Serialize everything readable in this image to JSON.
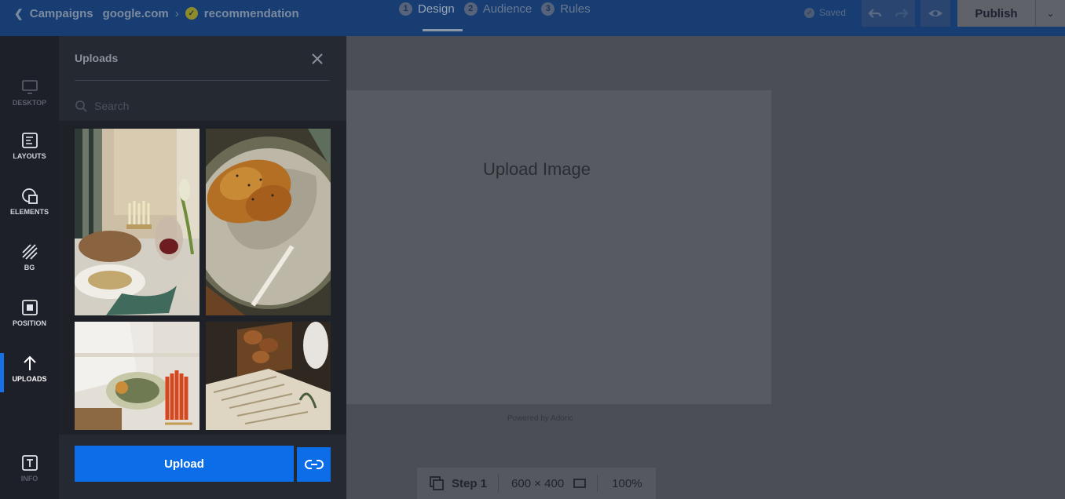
{
  "topbar": {
    "crumbs": [
      "Campaigns",
      "google.com",
      "recommendation"
    ],
    "steps": [
      {
        "num": "1",
        "label": "Design"
      },
      {
        "num": "2",
        "label": "Audience"
      },
      {
        "num": "3",
        "label": "Rules"
      }
    ],
    "saved_label": "Saved",
    "publish_label": "Publish"
  },
  "rail": {
    "items": [
      {
        "label": "DESKTOP",
        "icon": "monitor-icon"
      },
      {
        "label": "LAYOUTS",
        "icon": "layouts-icon"
      },
      {
        "label": "ELEMENTS",
        "icon": "elements-icon"
      },
      {
        "label": "BG",
        "icon": "background-icon"
      },
      {
        "label": "POSITION",
        "icon": "position-icon"
      },
      {
        "label": "UPLOADS",
        "icon": "upload-arrow-icon"
      },
      {
        "label": "INFO",
        "icon": "info-icon"
      }
    ],
    "active": "UPLOADS"
  },
  "panel": {
    "title": "Uploads",
    "search_placeholder": "Search",
    "images": [
      {
        "name": "holiday-dinner-table-image"
      },
      {
        "name": "challah-bread-image"
      },
      {
        "name": "menorah-meal-image"
      },
      {
        "name": "matzah-and-potatoes-image"
      }
    ],
    "upload_label": "Upload"
  },
  "canvas": {
    "placeholder_text": "Upload Image",
    "powered_by": "Powered by Adoric"
  },
  "bottombar": {
    "step_label": "Step 1",
    "size_label": "600 × 400",
    "zoom_label": "100%"
  },
  "colors": {
    "accent": "#0b6ee8",
    "topbar": "#173d72",
    "rail": "#1d2028",
    "panel": "#252932"
  }
}
